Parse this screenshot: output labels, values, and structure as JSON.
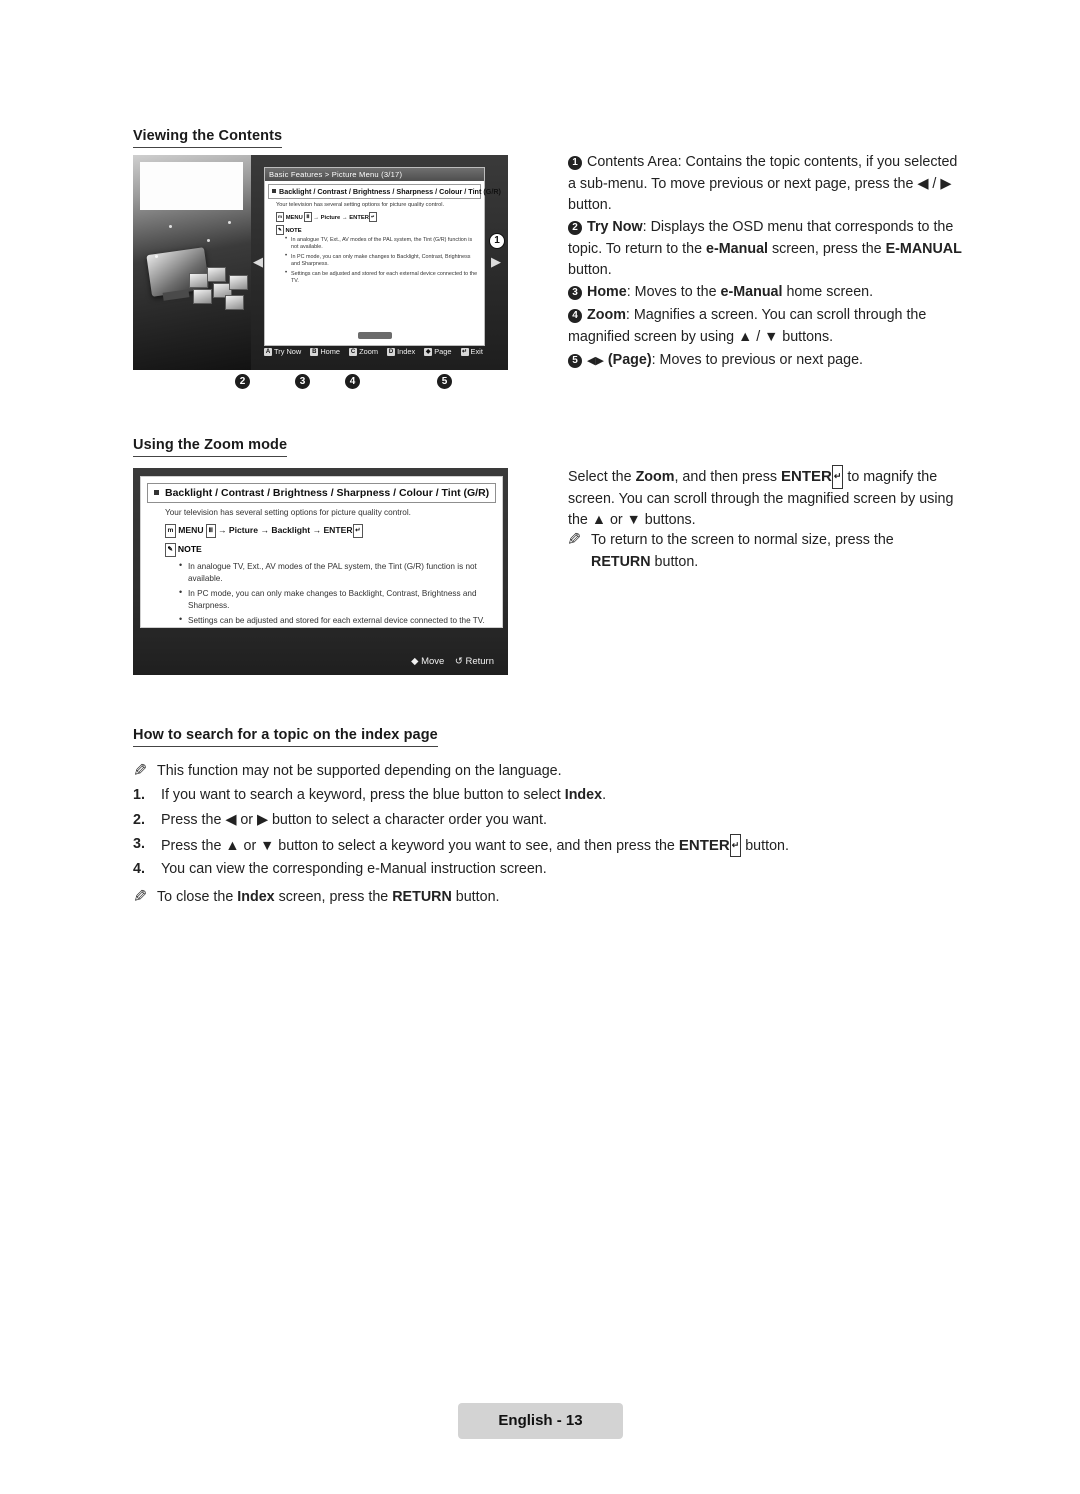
{
  "document": {
    "footer_label": "English - 13"
  },
  "sections": {
    "viewing_contents_title": "Viewing the Contents",
    "using_zoom_title": "Using the Zoom mode",
    "index_search_title": "How to search for a topic on the index page"
  },
  "figure1": {
    "header": "Basic Features > Picture Menu (3/17)",
    "row_title": "Backlight / Contrast / Brightness / Sharpness / Colour / Tint (G/R)",
    "sub": "Your television has several setting options for picture quality control.",
    "menu_path_prefix": "MENU",
    "menu_path": "→ Picture → ENTER",
    "note_label": "NOTE",
    "notes": [
      "In analogue TV, Ext., AV modes of the PAL system, the Tint (G/R) function is not available.",
      "In PC mode, you can only make changes to Backlight, Contrast, Brightness and Sharpness.",
      "Settings can be adjusted and stored for each external device connected to the TV."
    ],
    "bottom_bar": [
      {
        "key": "A",
        "label": "Try Now"
      },
      {
        "key": "B",
        "label": "Home"
      },
      {
        "key": "C",
        "label": "Zoom"
      },
      {
        "key": "D",
        "label": "Index"
      },
      {
        "key": "◀▶",
        "label": "Page"
      },
      {
        "key": "↵",
        "label": "Exit"
      }
    ],
    "badge_1": "1",
    "callouts": [
      "2",
      "3",
      "4",
      "5"
    ]
  },
  "figure2": {
    "row_title": "Backlight / Contrast / Brightness / Sharpness / Colour / Tint (G/R)",
    "sub": "Your television has several setting options for picture quality control.",
    "menu_path_prefix": "MENU",
    "menu_path": "→ Picture → Backlight → ENTER",
    "note_label": "NOTE",
    "notes": [
      "In analogue TV, Ext., AV modes of the PAL system, the Tint (G/R) function is not available.",
      "In PC mode, you can only make changes to Backlight, Contrast, Brightness and Sharpness.",
      "Settings can be adjusted and stored for each external device connected to the TV."
    ],
    "bar_move": "Move",
    "bar_return": "Return"
  },
  "right_column": {
    "item1": {
      "num": "1",
      "text": "Contents Area: Contains the topic contents, if you selected a sub-menu. To move previous or next page, press the ◀ / ▶ button."
    },
    "item2": {
      "num": "2",
      "label": "Try Now",
      "text_a": ": Displays the OSD menu that corresponds to the topic. To return to the ",
      "bold_b": "e-Manual",
      "text_b": " screen, press the ",
      "bold_c": "E-MANUAL",
      "text_c": " button."
    },
    "item3": {
      "num": "3",
      "label": "Home",
      "text_a": ": Moves to the ",
      "bold_b": "e-Manual",
      "text_b": " home screen."
    },
    "item4": {
      "num": "4",
      "label": "Zoom",
      "text": ": Magnifies a screen. You can scroll through the magnified screen by using ▲ / ▼ buttons."
    },
    "item5": {
      "num": "5",
      "glyph": "◀▶",
      "label": "(Page)",
      "text": ": Moves to previous or next page."
    },
    "zoom_para_a": "Select the ",
    "zoom_bold_zoom": "Zoom",
    "zoom_para_b": ", and then press ",
    "zoom_bold_enter": "ENTER",
    "zoom_para_c": " to magnify the screen. You can scroll through the magnified screen by using the ▲ or ▼ buttons.",
    "zoom_note_a": "To return to the screen to normal size, press the ",
    "zoom_note_bold": "RETURN",
    "zoom_note_b": " button."
  },
  "index_section": {
    "note": "This function may not be supported depending on the language.",
    "steps": [
      {
        "n": "1.",
        "text_a": "If you want to search a keyword, press the blue button to select ",
        "bold": "Index",
        "text_b": "."
      },
      {
        "n": "2.",
        "text_a": "Press the ◀ or ▶ button to select a character order you want.",
        "bold": "",
        "text_b": ""
      },
      {
        "n": "3.",
        "text_a": "Press the ▲ or ▼ button to select a keyword you want to see, and then press the ",
        "bold": "ENTER",
        "text_b": " button."
      },
      {
        "n": "4.",
        "text_a": "You can view the corresponding e-Manual instruction screen.",
        "bold": "",
        "text_b": ""
      }
    ],
    "close_note_a": "To close the ",
    "close_note_bold": "Index",
    "close_note_b": " screen, press the ",
    "close_note_bold2": "RETURN",
    "close_note_c": " button."
  }
}
